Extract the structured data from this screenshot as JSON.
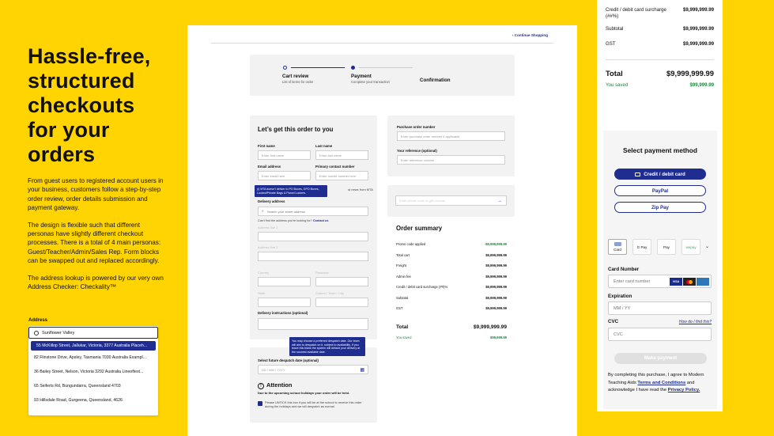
{
  "hero": {
    "title": "Hassle-free, structured checkouts for your orders",
    "p1": "From guest users to registered account users in your business, customers follow a step-by-step order review, order details submission and payment gateway.",
    "p2": "The design is flexible such that different personas have slightly different checkout processes. There is a total of 4 main personas: Guest/Teacher/Admin/Sales Rep. Form blocks can be swapped out and replaced accordingly.",
    "p3": "The address lookup is powered by our very own Address Checker: Checkality™"
  },
  "address_widget": {
    "label": "Address",
    "value": "Sunflower Valley",
    "options": [
      "55 McKillop Street, Jallukar, Victoria, 3377 Australia Placeh...",
      "82 Flinstone Drive, Apsley, Tasmania 7030 Australia Exampl...",
      "36 Bailey Street, Nelson, Victoria 3292 Australia Lineoftext...",
      "65 Seiferts Rd, Bungundarra, Queensland 4703",
      "93 Hillsdale Road, Gurgeena, Queensland, 4626"
    ]
  },
  "checkout": {
    "continue": "Continue Shopping",
    "steps": [
      {
        "title": "Cart review",
        "sub": "List of items for order"
      },
      {
        "title": "Payment",
        "sub": "Complete your transaction"
      },
      {
        "title": "Confirmation",
        "sub": ""
      }
    ],
    "delivery": {
      "title": "Let’s get this order to you",
      "first_name": "First name",
      "first_name_ph": "Enter first name",
      "last_name": "Last name",
      "last_name_ph": "Enter last name",
      "email": "Email address",
      "email_ph": "Enter email here",
      "phone": "Primary contact number",
      "phone_ph": "Enter mobile number here",
      "tooltip": "(i) MTA doesn’t deliver to PO Boxes, GPO Boxes, Locked/Private Bags & Parcel Lockers.",
      "news": "st news from MTA",
      "address_label": "Delivery address",
      "address_ph": "Search your street address",
      "cant_find": "Can't find the address you're looking for?",
      "contact_us": "Contact us",
      "line1": "Address line 1",
      "line2": "Address line 2",
      "country": "Country",
      "postcode": "Postcode",
      "state": "State",
      "suburb": "Suburb / Town / City",
      "instructions": "Delivery instructions (optional)"
    },
    "despatch": {
      "tooltip": "You may choose a preferred despatch date. Our team will aim to despatch on it, subject to availability. If you leave this blank the system will default your delivery at the soonest available date.",
      "label": "Select future despatch date (optional)",
      "placeholder": "DD / MM / YYYY",
      "attention": "Attention",
      "attention_body": "Due to the upcoming school holidays your order will be held.",
      "unticking": "Please UNTICK this box if you will be at the school to receive this order during the holidays and we will despatch as normal"
    },
    "po": {
      "po_label": "Purchase order number",
      "po_ph": "Enter purchase order number if applicable",
      "ref_label": "Your reference (optional)",
      "ref_ph": "Enter reference number"
    },
    "promo_ph": "Enter promo code or gift voucher",
    "summary": {
      "title": "Order summary",
      "rows": [
        {
          "label": "Promo code applied",
          "value": "-$9,999,999.99",
          "color": "#1a8a3a"
        },
        {
          "label": "Total cart",
          "value": "$9,999,999.99",
          "color": "#111"
        },
        {
          "label": "Freight",
          "value": "$9,999,999.99",
          "color": "#111"
        },
        {
          "label": "Admin fee",
          "value": "$9,999,999.99",
          "color": "#111"
        },
        {
          "label": "Credit / debit card surcharge (##)%",
          "value": "$9,999,999.99",
          "color": "#111"
        },
        {
          "label": "Subtotal",
          "value": "$9,999,999.99",
          "color": "#111"
        },
        {
          "label": "GST",
          "value": "$9,999,999.99",
          "color": "#111"
        }
      ],
      "total_label": "Total",
      "total_value": "$9,999,999.99",
      "saved_label": "You saved",
      "saved_value": "$99,999.99"
    }
  },
  "payment": {
    "surcharge_label": "Credit / debit card surcharge (##%)",
    "surcharge_value": "$9,999,999.99",
    "subtotal_label": "Subtotal",
    "subtotal_value": "$9,999,999.99",
    "gst_label": "GST",
    "gst_value": "$9,999,999.99",
    "total_label": "Total",
    "total_value": "$9,999,999.99",
    "saved_label": "You saved",
    "saved_value": "$99,999.99",
    "select_title": "Select payment method",
    "btn_card": "Credit / debit card",
    "btn_paypal": "PayPal",
    "btn_zip": "Zip Pay",
    "tiles": [
      "Card",
      "G Pay",
      " Pay",
      "wepay"
    ],
    "card_number_label": "Card Number",
    "card_number_ph": "Enter card number",
    "expiration_label": "Expiration",
    "expiration_ph": "MM / YY",
    "cvc_label": "CVC",
    "cvc_help": "How do I find this?",
    "cvc_ph": "CVC",
    "make_payment": "Make payment",
    "terms_pre": "By completing this purchase, I agree to Modern Teaching Aids",
    "terms_link": "Terms and Conditions",
    "terms_mid": "and acknowledge I have read the",
    "privacy_link": "Privacy Policy."
  }
}
